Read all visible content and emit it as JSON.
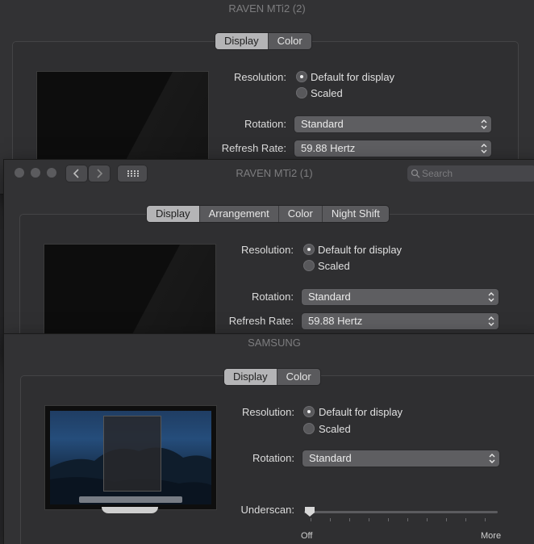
{
  "back_window": {
    "title": "RAVEN MTi2 (2)",
    "tabs": [
      "Display",
      "Color"
    ],
    "selected_tab": "Display",
    "resolution_label": "Resolution:",
    "resolution_options": [
      "Default for display",
      "Scaled"
    ],
    "rotation_label": "Rotation:",
    "rotation_value": "Standard",
    "refresh_label": "Refresh Rate:",
    "refresh_value": "59.88 Hertz"
  },
  "middle_window": {
    "title": "RAVEN MTi2 (1)",
    "search_placeholder": "Search",
    "tabs": [
      "Display",
      "Arrangement",
      "Color",
      "Night Shift"
    ],
    "selected_tab": "Display",
    "resolution_label": "Resolution:",
    "resolution_options": [
      "Default for display",
      "Scaled"
    ],
    "rotation_label": "Rotation:",
    "rotation_value": "Standard",
    "refresh_label": "Refresh Rate:",
    "refresh_value": "59.88 Hertz"
  },
  "front_window": {
    "title": "SAMSUNG",
    "tabs": [
      "Display",
      "Color"
    ],
    "selected_tab": "Display",
    "resolution_label": "Resolution:",
    "resolution_options": [
      "Default for display",
      "Scaled"
    ],
    "rotation_label": "Rotation:",
    "rotation_value": "Standard",
    "underscan_label": "Underscan:",
    "underscan_min": "Off",
    "underscan_max": "More",
    "underscan_level": 0
  },
  "icons": [
    "back-chevron-icon",
    "forward-chevron-icon",
    "grid-icon",
    "search-icon",
    "popup-arrows-icon"
  ],
  "colors": {
    "window_bg": "#323234",
    "selected_tab": "#b4b4b6",
    "control": "#5e5e61"
  }
}
